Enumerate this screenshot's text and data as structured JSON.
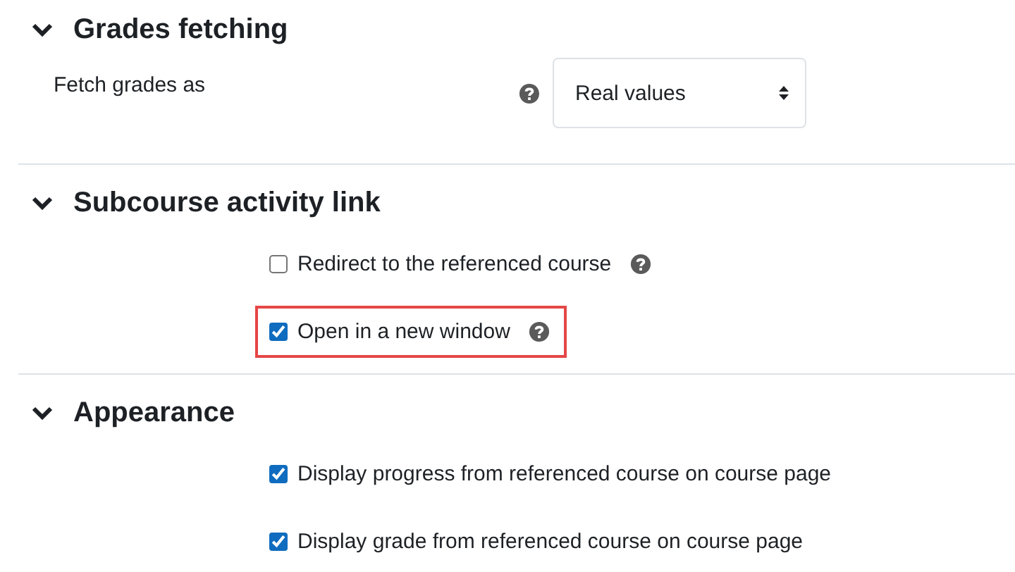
{
  "sections": [
    {
      "title": "Grades fetching",
      "expanded": true,
      "fields": [
        {
          "kind": "select",
          "label": "Fetch grades as",
          "help": true,
          "value": "Real values"
        }
      ]
    },
    {
      "title": "Subcourse activity link",
      "expanded": true,
      "fields": [
        {
          "kind": "checkbox",
          "label": "Redirect to the referenced course",
          "checked": false,
          "help": true,
          "highlighted": false
        },
        {
          "kind": "checkbox",
          "label": "Open in a new window",
          "checked": true,
          "help": true,
          "highlighted": true
        }
      ]
    },
    {
      "title": "Appearance",
      "expanded": true,
      "fields": [
        {
          "kind": "checkbox",
          "label": "Display progress from referenced course on course page",
          "checked": true,
          "help": false,
          "highlighted": false
        },
        {
          "kind": "checkbox",
          "label": "Display grade from referenced course on course page",
          "checked": true,
          "help": false,
          "highlighted": false
        }
      ]
    }
  ]
}
